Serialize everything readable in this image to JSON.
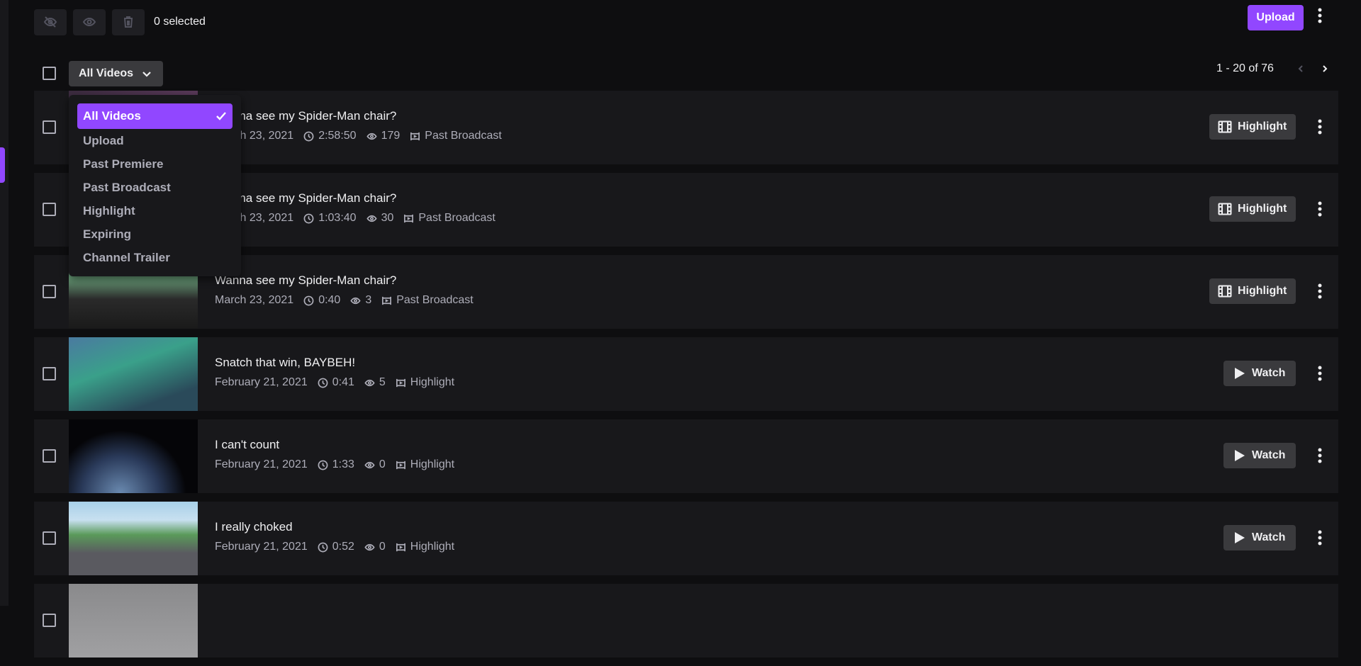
{
  "toolbar": {
    "hide_icon": "eye-off-icon",
    "show_icon": "eye-icon",
    "delete_icon": "trash-icon",
    "selected_text": "0 selected",
    "upload_label": "Upload"
  },
  "filter": {
    "selected": "All Videos",
    "options": [
      {
        "label": "All Videos",
        "selected": true
      },
      {
        "label": "Upload",
        "selected": false
      },
      {
        "label": "Past Premiere",
        "selected": false
      },
      {
        "label": "Past Broadcast",
        "selected": false
      },
      {
        "label": "Highlight",
        "selected": false
      },
      {
        "label": "Expiring",
        "selected": false
      },
      {
        "label": "Channel Trailer",
        "selected": false
      }
    ]
  },
  "pagination": {
    "text": "1 - 20 of 76"
  },
  "videos": [
    {
      "title": "Wanna see my Spider-Man chair?",
      "date": "March 23, 2021",
      "duration": "2:58:50",
      "views": "179",
      "type": "Past Broadcast",
      "action": "Highlight"
    },
    {
      "title": "Wanna see my Spider-Man chair?",
      "date": "March 23, 2021",
      "duration": "1:03:40",
      "views": "30",
      "type": "Past Broadcast",
      "action": "Highlight"
    },
    {
      "title": "Wanna see my Spider-Man chair?",
      "date": "March 23, 2021",
      "duration": "0:40",
      "views": "3",
      "type": "Past Broadcast",
      "action": "Highlight"
    },
    {
      "title": "Snatch that win, BAYBEH!",
      "date": "February 21, 2021",
      "duration": "0:41",
      "views": "5",
      "type": "Highlight",
      "action": "Watch"
    },
    {
      "title": "I can't count",
      "date": "February 21, 2021",
      "duration": "1:33",
      "views": "0",
      "type": "Highlight",
      "action": "Watch"
    },
    {
      "title": "I really choked",
      "date": "February 21, 2021",
      "duration": "0:52",
      "views": "0",
      "type": "Highlight",
      "action": "Watch"
    },
    {
      "title": "",
      "date": "",
      "duration": "",
      "views": "",
      "type": "",
      "action": ""
    }
  ],
  "colors": {
    "accent": "#9147ff",
    "background": "#0e0e10",
    "row": "#18181b",
    "button": "#3a3a3d"
  }
}
